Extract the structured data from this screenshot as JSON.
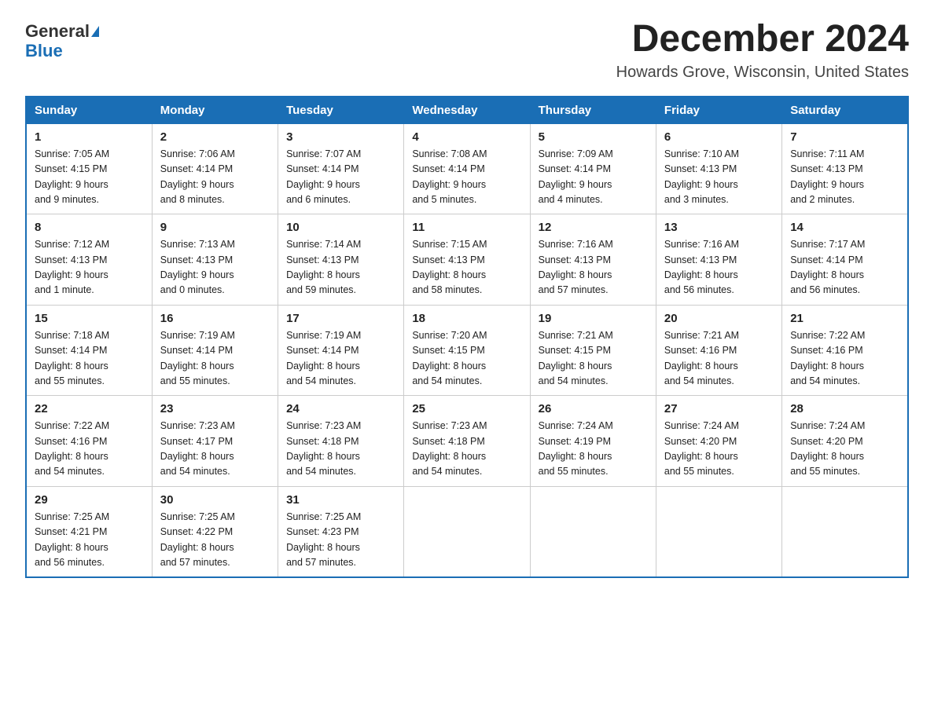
{
  "logo": {
    "line1": "General",
    "arrow": true,
    "line2": "Blue"
  },
  "header": {
    "month_title": "December 2024",
    "location": "Howards Grove, Wisconsin, United States"
  },
  "days_of_week": [
    "Sunday",
    "Monday",
    "Tuesday",
    "Wednesday",
    "Thursday",
    "Friday",
    "Saturday"
  ],
  "weeks": [
    [
      {
        "day": "1",
        "sunrise": "7:05 AM",
        "sunset": "4:15 PM",
        "daylight": "9 hours and 9 minutes."
      },
      {
        "day": "2",
        "sunrise": "7:06 AM",
        "sunset": "4:14 PM",
        "daylight": "9 hours and 8 minutes."
      },
      {
        "day": "3",
        "sunrise": "7:07 AM",
        "sunset": "4:14 PM",
        "daylight": "9 hours and 6 minutes."
      },
      {
        "day": "4",
        "sunrise": "7:08 AM",
        "sunset": "4:14 PM",
        "daylight": "9 hours and 5 minutes."
      },
      {
        "day": "5",
        "sunrise": "7:09 AM",
        "sunset": "4:14 PM",
        "daylight": "9 hours and 4 minutes."
      },
      {
        "day": "6",
        "sunrise": "7:10 AM",
        "sunset": "4:13 PM",
        "daylight": "9 hours and 3 minutes."
      },
      {
        "day": "7",
        "sunrise": "7:11 AM",
        "sunset": "4:13 PM",
        "daylight": "9 hours and 2 minutes."
      }
    ],
    [
      {
        "day": "8",
        "sunrise": "7:12 AM",
        "sunset": "4:13 PM",
        "daylight": "9 hours and 1 minute."
      },
      {
        "day": "9",
        "sunrise": "7:13 AM",
        "sunset": "4:13 PM",
        "daylight": "9 hours and 0 minutes."
      },
      {
        "day": "10",
        "sunrise": "7:14 AM",
        "sunset": "4:13 PM",
        "daylight": "8 hours and 59 minutes."
      },
      {
        "day": "11",
        "sunrise": "7:15 AM",
        "sunset": "4:13 PM",
        "daylight": "8 hours and 58 minutes."
      },
      {
        "day": "12",
        "sunrise": "7:16 AM",
        "sunset": "4:13 PM",
        "daylight": "8 hours and 57 minutes."
      },
      {
        "day": "13",
        "sunrise": "7:16 AM",
        "sunset": "4:13 PM",
        "daylight": "8 hours and 56 minutes."
      },
      {
        "day": "14",
        "sunrise": "7:17 AM",
        "sunset": "4:14 PM",
        "daylight": "8 hours and 56 minutes."
      }
    ],
    [
      {
        "day": "15",
        "sunrise": "7:18 AM",
        "sunset": "4:14 PM",
        "daylight": "8 hours and 55 minutes."
      },
      {
        "day": "16",
        "sunrise": "7:19 AM",
        "sunset": "4:14 PM",
        "daylight": "8 hours and 55 minutes."
      },
      {
        "day": "17",
        "sunrise": "7:19 AM",
        "sunset": "4:14 PM",
        "daylight": "8 hours and 54 minutes."
      },
      {
        "day": "18",
        "sunrise": "7:20 AM",
        "sunset": "4:15 PM",
        "daylight": "8 hours and 54 minutes."
      },
      {
        "day": "19",
        "sunrise": "7:21 AM",
        "sunset": "4:15 PM",
        "daylight": "8 hours and 54 minutes."
      },
      {
        "day": "20",
        "sunrise": "7:21 AM",
        "sunset": "4:16 PM",
        "daylight": "8 hours and 54 minutes."
      },
      {
        "day": "21",
        "sunrise": "7:22 AM",
        "sunset": "4:16 PM",
        "daylight": "8 hours and 54 minutes."
      }
    ],
    [
      {
        "day": "22",
        "sunrise": "7:22 AM",
        "sunset": "4:16 PM",
        "daylight": "8 hours and 54 minutes."
      },
      {
        "day": "23",
        "sunrise": "7:23 AM",
        "sunset": "4:17 PM",
        "daylight": "8 hours and 54 minutes."
      },
      {
        "day": "24",
        "sunrise": "7:23 AM",
        "sunset": "4:18 PM",
        "daylight": "8 hours and 54 minutes."
      },
      {
        "day": "25",
        "sunrise": "7:23 AM",
        "sunset": "4:18 PM",
        "daylight": "8 hours and 54 minutes."
      },
      {
        "day": "26",
        "sunrise": "7:24 AM",
        "sunset": "4:19 PM",
        "daylight": "8 hours and 55 minutes."
      },
      {
        "day": "27",
        "sunrise": "7:24 AM",
        "sunset": "4:20 PM",
        "daylight": "8 hours and 55 minutes."
      },
      {
        "day": "28",
        "sunrise": "7:24 AM",
        "sunset": "4:20 PM",
        "daylight": "8 hours and 55 minutes."
      }
    ],
    [
      {
        "day": "29",
        "sunrise": "7:25 AM",
        "sunset": "4:21 PM",
        "daylight": "8 hours and 56 minutes."
      },
      {
        "day": "30",
        "sunrise": "7:25 AM",
        "sunset": "4:22 PM",
        "daylight": "8 hours and 57 minutes."
      },
      {
        "day": "31",
        "sunrise": "7:25 AM",
        "sunset": "4:23 PM",
        "daylight": "8 hours and 57 minutes."
      },
      null,
      null,
      null,
      null
    ]
  ],
  "labels": {
    "sunrise": "Sunrise:",
    "sunset": "Sunset:",
    "daylight": "Daylight:"
  }
}
